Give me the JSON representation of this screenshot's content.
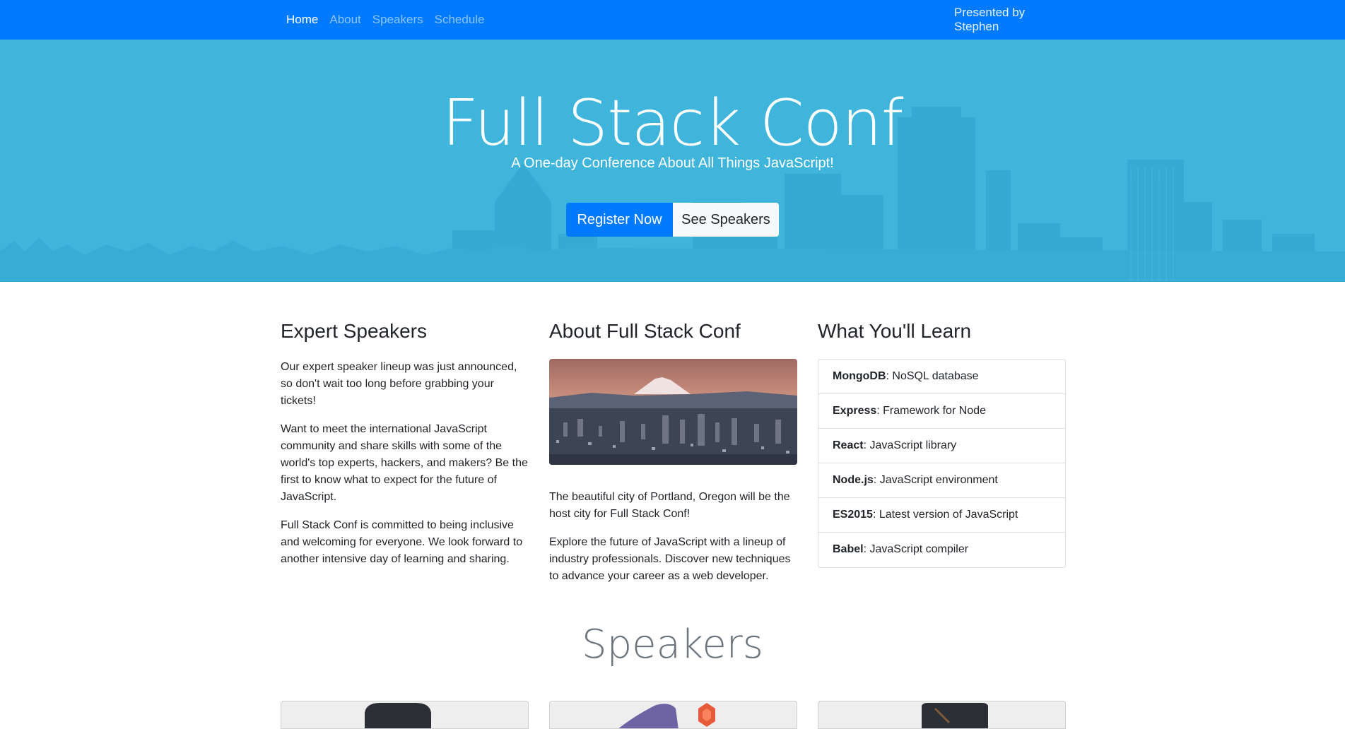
{
  "nav": {
    "links": [
      "Home",
      "About",
      "Speakers",
      "Schedule"
    ],
    "right_text": "Presented by Stephen"
  },
  "hero": {
    "title": "Full Stack Conf",
    "subtitle": "A One-day Conference About All Things JavaScript!",
    "register_label": "Register Now",
    "speakers_label": "See Speakers"
  },
  "speakers_col": {
    "heading": "Expert Speakers",
    "p1": "Our expert speaker lineup was just announced, so don't wait too long before grabbing your tickets!",
    "p2": "Want to meet the international JavaScript community and share skills with some of the world's top experts, hackers, and makers? Be the first to know what to expect for the future of JavaScript.",
    "p3": "Full Stack Conf is committed to being inclusive and welcoming for everyone. We look forward to another intensive day of learning and sharing."
  },
  "about_col": {
    "heading": "About Full Stack Conf",
    "p1": "The beautiful city of Portland, Oregon will be the host city for Full Stack Conf!",
    "p2": "Explore the future of JavaScript with a lineup of industry professionals. Discover new techniques to advance your career as a web developer."
  },
  "learn_col": {
    "heading": "What You'll Learn",
    "items": [
      {
        "name": "MongoDB",
        "desc": ": NoSQL database"
      },
      {
        "name": "Express",
        "desc": ": Framework for Node"
      },
      {
        "name": "React",
        "desc": ": JavaScript library"
      },
      {
        "name": "Node.js",
        "desc": ": JavaScript environment"
      },
      {
        "name": "ES2015",
        "desc": ": Latest version of JavaScript"
      },
      {
        "name": "Babel",
        "desc": ": JavaScript compiler"
      }
    ]
  },
  "speakers_section": {
    "title": "Speakers"
  },
  "colors": {
    "nav_bg": "#007bff",
    "hero_bg": "#3fb5dc",
    "primary": "#007bff"
  }
}
